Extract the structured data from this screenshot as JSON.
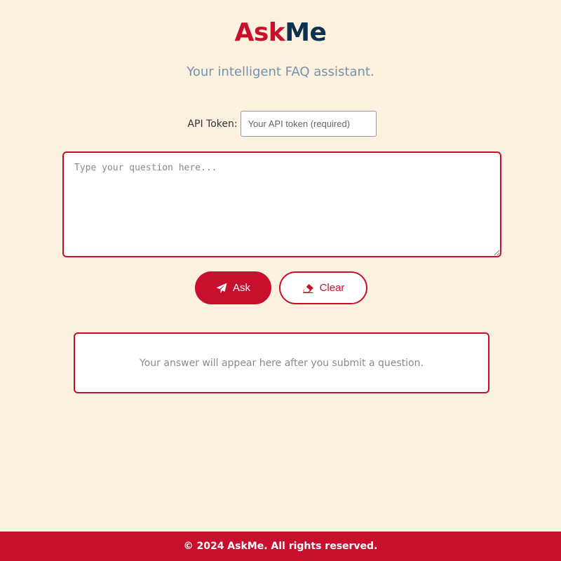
{
  "header": {
    "title_part1": "Ask",
    "title_part2": "Me",
    "subtitle": "Your intelligent FAQ assistant."
  },
  "token": {
    "label": "API Token:",
    "value": "",
    "placeholder": "Your API token (required)"
  },
  "question": {
    "value": "",
    "placeholder": "Type your question here..."
  },
  "actions": {
    "ask_label": "Ask",
    "ask_icon": "paper-plane-icon",
    "clear_label": "Clear",
    "clear_icon": "eraser-icon"
  },
  "answer": {
    "placeholder_text": "Your answer will appear here after you submit a question."
  },
  "footer": {
    "text": "© 2024 AskMe. All rights reserved."
  },
  "colors": {
    "brand_red": "#c8102e",
    "brand_navy": "#0f3150",
    "background": "#fcf1de",
    "subtitle": "#7393b0"
  }
}
